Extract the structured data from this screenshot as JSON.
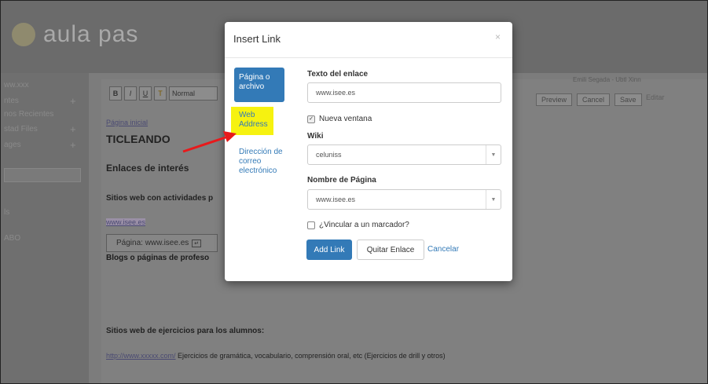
{
  "app": {
    "logo_text": "aula pas"
  },
  "sidebar": {
    "items": [
      {
        "label": "ww.xxx",
        "plus": false
      },
      {
        "label": "ntes",
        "plus": true
      },
      {
        "label": "nos Recientes",
        "plus": false
      },
      {
        "label": "stad Files",
        "plus": true
      },
      {
        "label": "ages",
        "plus": true
      },
      {
        "label": "ls",
        "plus": false
      },
      {
        "label": "ABO",
        "plus": false
      }
    ]
  },
  "editor": {
    "toolbar": {
      "bold": "B",
      "italic": "I",
      "underline": "U",
      "format_label": "Normal"
    },
    "right_tools": {
      "preview": "Preview",
      "cancel": "Cancel",
      "save": "Save",
      "editar": "Editar"
    },
    "user_line": "Emili Segada - Ubtl Xinn",
    "breadcrumb": "Página inicial",
    "heading": "TICLEANDO",
    "section_title": "Enlaces de interés",
    "sites_label": "Sitios web con actividades p",
    "link_text": "www.isee.es",
    "page_tooltip": "Página: www.isee.es",
    "partial_line": "Blogs o páginas de profeso",
    "exercises_title": "Sitios web de ejercicios para los alumnos:",
    "exercises_link": "http://www.xxxxx.com/",
    "exercises_desc": " Ejercicios de gramática, vocabulario, comprensión oral, etc (Ejercicios de drill y otros)"
  },
  "modal": {
    "title": "Insert Link",
    "close_symbol": "×",
    "nav": {
      "page_or_file": "Página o archivo",
      "web_address": "Web Address",
      "email": "Dirección de correo electrónico"
    },
    "form": {
      "link_text_label": "Texto del enlace",
      "link_text_value": "www.isee.es",
      "new_window_label": "Nueva ventana",
      "new_window_checked": true,
      "wiki_label": "Wiki",
      "wiki_value": "celuniss",
      "page_name_label": "Nombre de Página",
      "page_name_value": "www.isee.es",
      "anchor_label": "¿Vincular a un marcador?",
      "anchor_checked": false
    },
    "buttons": {
      "add_link": "Add Link",
      "remove_link": "Quitar Enlace",
      "cancel": "Cancelar"
    }
  },
  "colors": {
    "primary": "#337ab7",
    "highlight": "#f6f210",
    "arrow": "#e8191b",
    "overlay": "#7c7c7c"
  }
}
